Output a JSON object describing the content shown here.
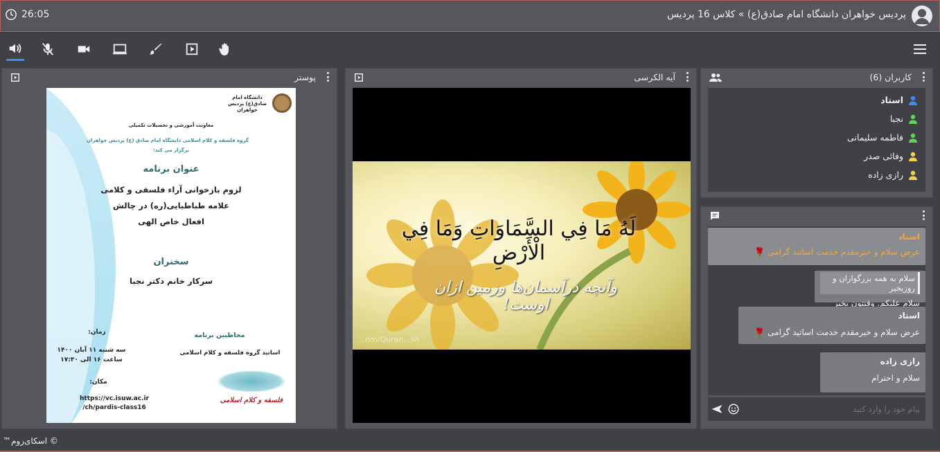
{
  "topbar": {
    "timer": "26:05",
    "room_title": "پردیس خواهران دانشگاه امام صادق(ع) » کلاس 16 پردیس"
  },
  "toolbar": {
    "icons": [
      "speaker-icon",
      "mic-off-icon",
      "camera-icon",
      "screen-share-icon",
      "brush-icon",
      "play-box-icon",
      "raise-hand-icon",
      "hamburger-menu-icon"
    ]
  },
  "poster_panel": {
    "title": "پوستر",
    "poster": {
      "logo_text": "دانشگاه امام صادق(ع) پردیس خواهران",
      "dept": "معاونت آموزشی و تحصیلات تکمیلی",
      "organizer": "گروه فلسفه و کلام اسلامی دانشگاه امام صادق (ع) پردیس خواهران",
      "organizer2": "برگزار می کند:",
      "program_heading": "عنوان برنامه",
      "program_line1": "لزوم بازخوانی آراء فلسفی و کلامی",
      "program_line2": "علامه طباطبایی(ره) در چالش",
      "program_line3": "افعال خاص الهی",
      "speaker_heading": "سخنران",
      "speaker": "سرکار خانم دکتر نجبا",
      "time_heading": "زمان:",
      "time_line1": "سه شنبه ۱۱ آبان ۱۴۰۰",
      "time_line2": "ساعت ۱۶ الی ۱۷:۳۰",
      "audience_heading": "مخاطبین برنامه",
      "audience": "اساتید گروه فلسفه و کلام اسلامی",
      "place_heading": "مکان:",
      "url_line1": "https://vc.isuw.ac.ir",
      "url_line2": "/ch/pardis-class16",
      "seal_text": "فلسفه و کلام اسلامی"
    }
  },
  "video_panel": {
    "title": "آیه الکرسی",
    "ayah": "لَهُ مَا فِي السَّمَاوَاتِ وَمَا فِي الْأَرْضِ",
    "translation": "وآنچه درآسمان‌ها وزمین ازان اوست!",
    "watermark": "...om/Quran...sh"
  },
  "users_panel": {
    "title": "کاربران (6)",
    "users": [
      {
        "name": "استاد",
        "color": "#3d8df5",
        "bold": true
      },
      {
        "name": "نجبا",
        "color": "#5fd35f",
        "bold": false
      },
      {
        "name": "فاطمه سلیمانی",
        "color": "#5fd35f",
        "bold": false
      },
      {
        "name": "وفائی صدر",
        "color": "#f2d14b",
        "bold": false
      },
      {
        "name": "رازی زاده",
        "color": "#f2d14b",
        "bold": false
      }
    ]
  },
  "chat_panel": {
    "messages": [
      {
        "name": "استاد",
        "text": "عرض سلام و خیرمقدم خدمت اساتید گرامی"
      },
      {
        "name": "",
        "text": "سلام به همه بزرگواران و روزبخیر",
        "text2": "سلام علیکم. وقتتون بخیر"
      },
      {
        "name": "استاد",
        "text": "عرض سلام و خیرمقدم خدمت اساتید گرامی"
      },
      {
        "name": "رازی زاده",
        "text": "سلام و احترام"
      }
    ],
    "input_placeholder": "پیام خود را وارد کنید"
  },
  "footer": {
    "copyright": "© اسکای‌روم™"
  },
  "colors": {
    "accent": "#3d8df5",
    "teacher_highlight": "#f3a93b"
  }
}
